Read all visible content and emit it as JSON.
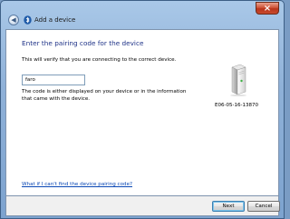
{
  "window": {
    "title": "Add a device",
    "close_label": "×",
    "back_label": "◀"
  },
  "page": {
    "heading": "Enter the pairing code for the device",
    "description": "This will verify that you are connecting to the correct device.",
    "code_input": {
      "value": "faro",
      "placeholder": ""
    },
    "hint": "The code is either displayed on your device or in the information that came with the device.",
    "help_link": "What if I can't find the device pairing code?"
  },
  "device": {
    "id": "E06-05-16-13870",
    "icon": "computer-tower-icon",
    "status_color": "#3cb043"
  },
  "footer": {
    "next_label": "Next",
    "cancel_label": "Cancel"
  },
  "colors": {
    "heading": "#1e3287",
    "link": "#0b48b5",
    "close": "#c94a2e"
  }
}
